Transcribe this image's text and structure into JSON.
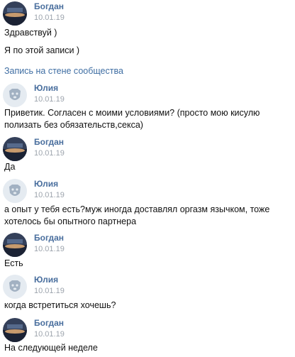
{
  "messages": [
    {
      "author": "Богдан",
      "date": "10.01.19",
      "avatar": "user-photo-bogdan"
    },
    {
      "author": "Юлия",
      "date": "10.01.19",
      "avatar": "deactivated-dog-avatar"
    },
    {
      "author": "Богдан",
      "date": "10.01.19",
      "avatar": "user-photo-bogdan"
    },
    {
      "author": "Юлия",
      "date": "10.01.19",
      "avatar": "deactivated-dog-avatar"
    },
    {
      "author": "Богдан",
      "date": "10.01.19",
      "avatar": "user-photo-bogdan"
    },
    {
      "author": "Юлия",
      "date": "10.01.19",
      "avatar": "deactivated-dog-avatar"
    },
    {
      "author": "Богдан",
      "date": "10.01.19",
      "avatar": "user-photo-bogdan"
    }
  ],
  "texts": {
    "t1": "Здравствуй )",
    "t2": "Я по этой записи )",
    "t3": "Приветик. Согласен с моими условиями? (просто мою кисулю",
    "t3b": "полизать без обязательств,секса)",
    "t4": "Да",
    "t5": "а опыт у тебя есть?муж иногда доставлял оргазм язычком, тоже",
    "t5b": "хотелось бы опытного партнера",
    "t6": "Есть",
    "t7": "когда встретиться хочешь?",
    "t8": "На следующей неделе"
  },
  "wall_link": "Запись на стене сообщества",
  "colors": {
    "author": "#4a6f9e",
    "date": "#9da4ad",
    "link": "#3f6ea3",
    "dog_bg": "#e5ebf1",
    "dog_fg": "#a2b1c2"
  }
}
